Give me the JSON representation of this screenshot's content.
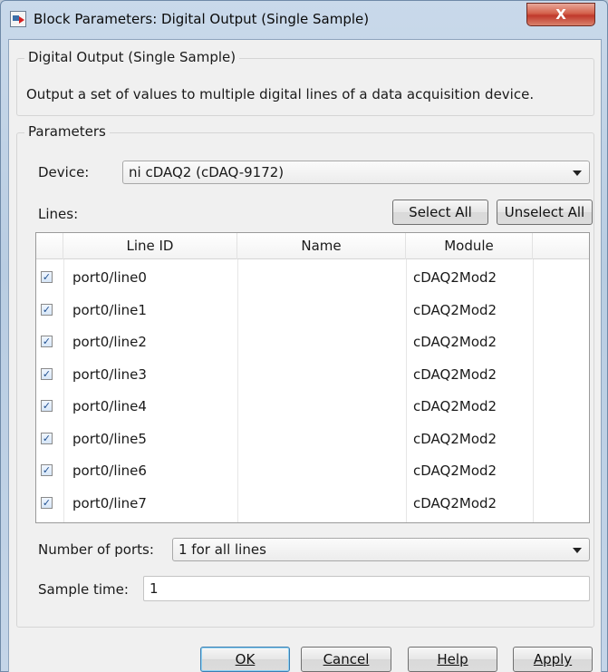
{
  "window": {
    "title": "Block Parameters: Digital Output (Single Sample)",
    "close_label": "X"
  },
  "description": {
    "group_title": "Digital Output (Single Sample)",
    "text": "Output a set of values to multiple digital lines of a data acquisition device."
  },
  "parameters": {
    "group_title": "Parameters",
    "device_label": "Device:",
    "device_value": "ni cDAQ2 (cDAQ-9172)",
    "lines_label": "Lines:",
    "select_all_label": "Select All",
    "unselect_all_label": "Unselect All",
    "table": {
      "columns": [
        "Line ID",
        "Name",
        "Module"
      ],
      "rows": [
        {
          "checked": true,
          "line_id": "port0/line0",
          "name": "",
          "module": "cDAQ2Mod2"
        },
        {
          "checked": true,
          "line_id": "port0/line1",
          "name": "",
          "module": "cDAQ2Mod2"
        },
        {
          "checked": true,
          "line_id": "port0/line2",
          "name": "",
          "module": "cDAQ2Mod2"
        },
        {
          "checked": true,
          "line_id": "port0/line3",
          "name": "",
          "module": "cDAQ2Mod2"
        },
        {
          "checked": true,
          "line_id": "port0/line4",
          "name": "",
          "module": "cDAQ2Mod2"
        },
        {
          "checked": true,
          "line_id": "port0/line5",
          "name": "",
          "module": "cDAQ2Mod2"
        },
        {
          "checked": true,
          "line_id": "port0/line6",
          "name": "",
          "module": "cDAQ2Mod2"
        },
        {
          "checked": true,
          "line_id": "port0/line7",
          "name": "",
          "module": "cDAQ2Mod2"
        }
      ]
    },
    "ports_label": "Number of ports:",
    "ports_value": "1 for all lines",
    "sample_time_label": "Sample time:",
    "sample_time_value": "1"
  },
  "buttons": {
    "ok": "OK",
    "cancel": "Cancel",
    "help": "Help",
    "apply": "Apply"
  },
  "colors": {
    "titlebar": "#c4d5e8",
    "close_button": "#c0392b",
    "dialog_background": "#f0f0f0"
  }
}
